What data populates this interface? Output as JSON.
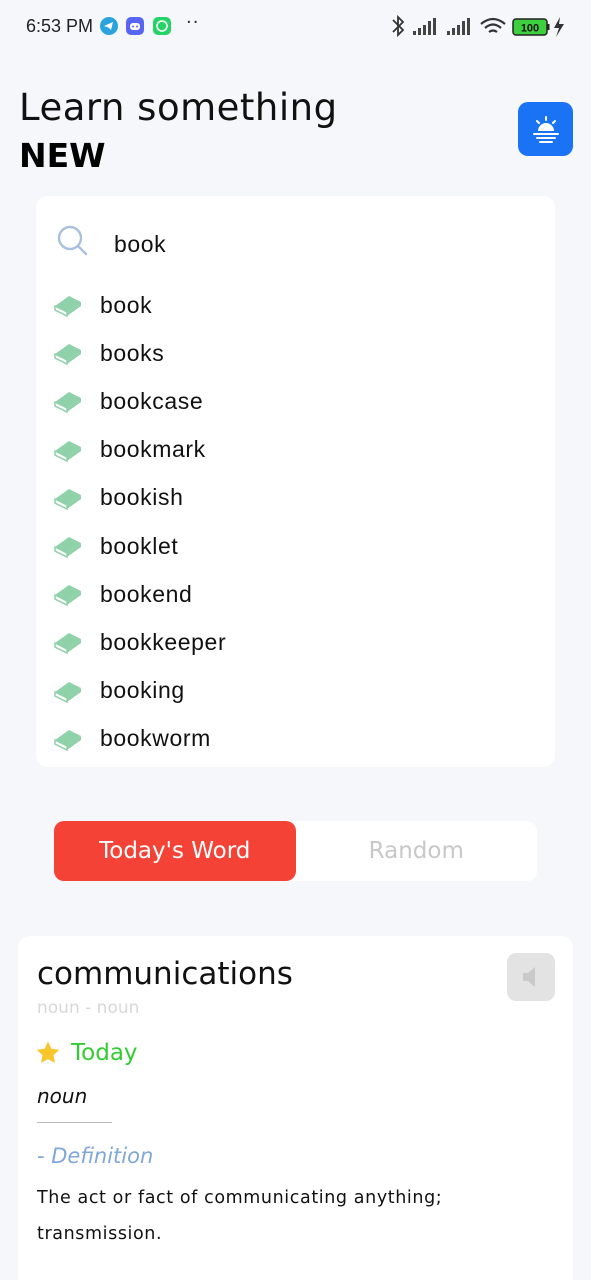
{
  "status_bar": {
    "time": "6:53 PM",
    "dots": "··",
    "battery": "100",
    "icons": [
      "telegram-icon",
      "discord-icon",
      "whatsapp-icon",
      "bluetooth-icon",
      "signal-icon",
      "wifi-icon",
      "battery-icon",
      "charging-icon"
    ]
  },
  "header": {
    "line1": "Learn something",
    "line2": "NEW",
    "theme_icon": "sunrise-icon",
    "accent": "#1a73f5"
  },
  "search": {
    "value": "book",
    "icon": "search-icon",
    "suggestions": [
      {
        "label": "book"
      },
      {
        "label": "books"
      },
      {
        "label": "bookcase"
      },
      {
        "label": "bookmark"
      },
      {
        "label": "bookish"
      },
      {
        "label": "booklet"
      },
      {
        "label": "bookend"
      },
      {
        "label": "bookkeeper"
      },
      {
        "label": "booking"
      },
      {
        "label": "bookworm"
      }
    ],
    "suggestion_icon": "book-icon",
    "suggestion_icon_color": "#8fd1a8"
  },
  "tabs": {
    "active": "Today's Word",
    "inactive": "Random",
    "active_color": "#f44336"
  },
  "word_card": {
    "word": "communications",
    "subtitle": "noun - noun",
    "badge_icon": "star-icon",
    "badge_label": "Today",
    "part_of_speech": "noun",
    "definition_heading": "- Definition",
    "definition": "The act or fact of communicating anything; transmission.",
    "speak_icon": "speaker-icon"
  }
}
